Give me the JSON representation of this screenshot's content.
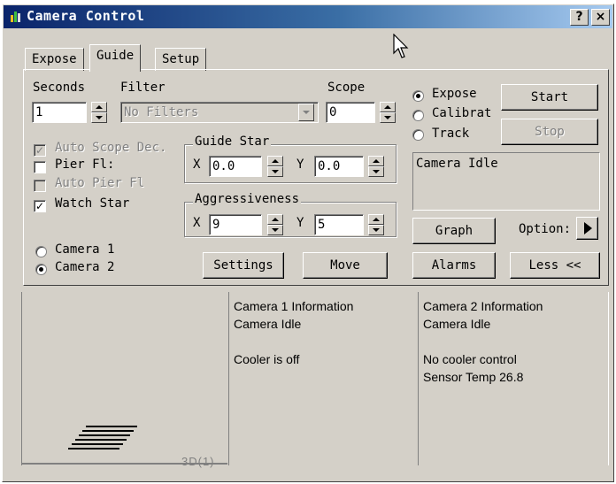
{
  "window": {
    "title": "Camera Control",
    "help_label": "?",
    "close_label": "×"
  },
  "tabs": [
    {
      "label": "Expose"
    },
    {
      "label": "Guide"
    },
    {
      "label": "Setup"
    }
  ],
  "guide": {
    "seconds_label": "Seconds",
    "seconds_value": "1",
    "filter_label": "Filter",
    "filter_value": "No Filters",
    "scope_label": "Scope",
    "scope_value": "0",
    "auto_scope_dec_label": "Auto Scope Dec.",
    "pier_flip_label": "Pier Fl:",
    "auto_pier_flip_label": "Auto Pier Fl",
    "watch_star_label": "Watch Star",
    "guide_star": {
      "title": "Guide Star",
      "x_label": "X",
      "x_value": "0.0",
      "y_label": "Y",
      "y_value": "0.0"
    },
    "aggressiveness": {
      "title": "Aggressiveness",
      "x_label": "X",
      "x_value": "9",
      "y_label": "Y",
      "y_value": "5"
    },
    "camera1_label": "Camera 1",
    "camera2_label": "Camera 2",
    "settings_label": "Settings",
    "move_label": "Move"
  },
  "mode": {
    "expose_label": "Expose",
    "calibrate_label": "Calibrat",
    "track_label": "Track",
    "selected": "Expose"
  },
  "buttons": {
    "start": "Start",
    "stop": "Stop",
    "graph": "Graph",
    "options": "Option:",
    "alarms": "Alarms",
    "less": "Less <<"
  },
  "status_text": "Camera Idle",
  "preview": {
    "label": "3D(1)"
  },
  "camera1_info": {
    "title": "Camera 1 Information",
    "state": "Camera Idle",
    "cooler": "Cooler is off"
  },
  "camera2_info": {
    "title": "Camera 2 Information",
    "state": "Camera Idle",
    "cooler": "No cooler control",
    "temp": "Sensor Temp 26.8"
  }
}
